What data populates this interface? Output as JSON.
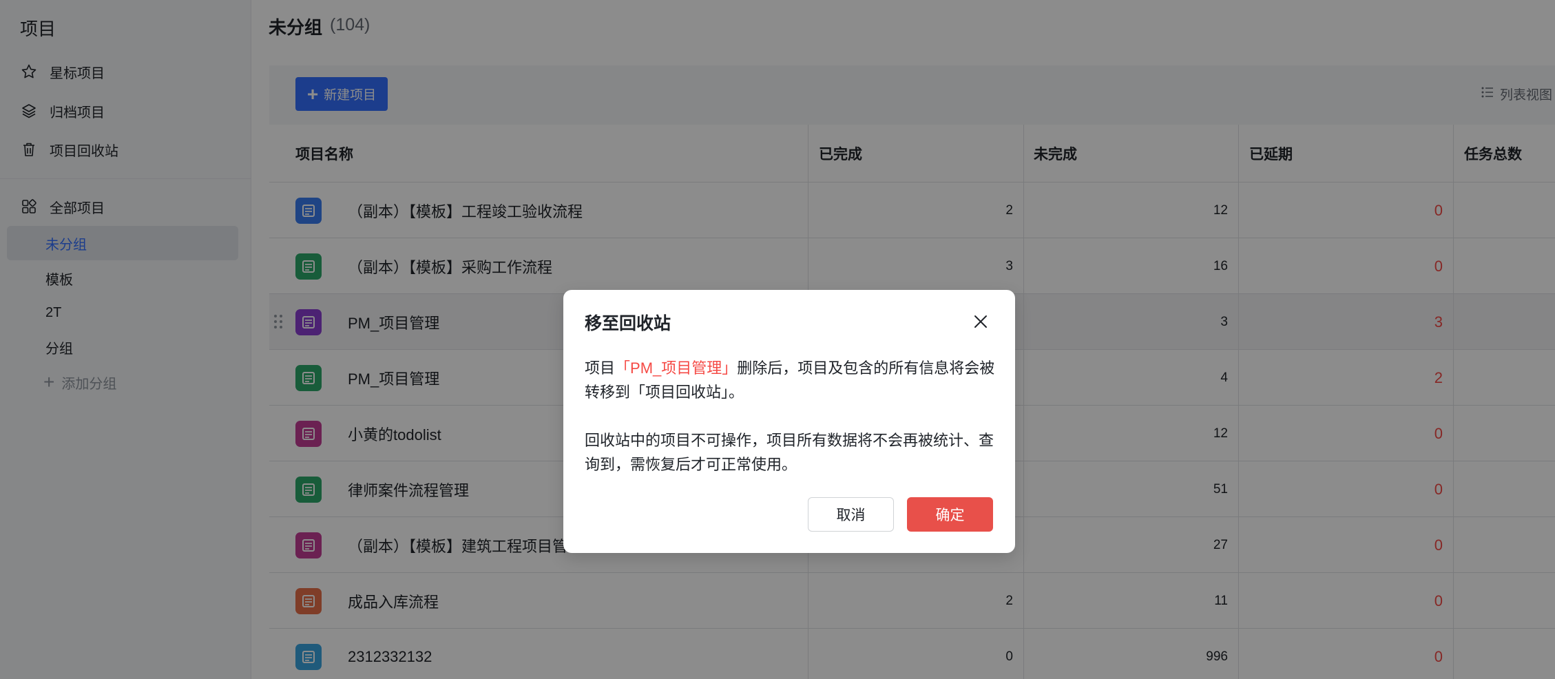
{
  "sidebar": {
    "title": "项目",
    "items": [
      {
        "label": "星标项目",
        "icon": "star-icon"
      },
      {
        "label": "归档项目",
        "icon": "layers-icon"
      },
      {
        "label": "项目回收站",
        "icon": "trash-icon"
      },
      {
        "label": "全部项目",
        "icon": "grid-icon"
      }
    ],
    "groups": [
      {
        "label": "未分组"
      },
      {
        "label": "模板"
      },
      {
        "label": "2T"
      },
      {
        "label": "分组"
      }
    ],
    "add_group_label": "添加分组"
  },
  "main": {
    "title": "未分组",
    "count": "(104)",
    "new_button_label": "新建项目",
    "view_label": "列表视图",
    "columns": [
      "项目名称",
      "已完成",
      "未完成",
      "已延期",
      "任务总数"
    ],
    "rows": [
      {
        "name": "（副本）【模板】工程竣工验收流程",
        "done": "2",
        "undone": "12",
        "delayed": "0",
        "icon_color": "#3a7cf0"
      },
      {
        "name": "（副本）【模板】采购工作流程",
        "done": "3",
        "undone": "16",
        "delayed": "0",
        "icon_color": "#2ca86a"
      },
      {
        "name": "PM_项目管理",
        "done": "",
        "undone": "3",
        "delayed": "3",
        "icon_color": "#8a3fd1"
      },
      {
        "name": "PM_项目管理",
        "done": "",
        "undone": "4",
        "delayed": "2",
        "icon_color": "#2ca86a"
      },
      {
        "name": "小黄的todolist",
        "done": "",
        "undone": "12",
        "delayed": "0",
        "icon_color": "#c43d96"
      },
      {
        "name": "律师案件流程管理",
        "done": "",
        "undone": "51",
        "delayed": "0",
        "icon_color": "#2ca86a"
      },
      {
        "name": "（副本）【模板】建筑工程项目管理",
        "done": "",
        "undone": "27",
        "delayed": "0",
        "icon_color": "#c43d96"
      },
      {
        "name": "成品入库流程",
        "done": "2",
        "undone": "11",
        "delayed": "0",
        "icon_color": "#e8704a"
      },
      {
        "name": "2312332132",
        "done": "0",
        "undone": "996",
        "delayed": "0",
        "icon_color": "#3aa5e0"
      }
    ]
  },
  "dialog": {
    "title": "移至回收站",
    "body_prefix": "项目",
    "highlight": "「PM_项目管理」",
    "body_suffix": "删除后，项目及包含的所有信息将会被转移到「项目回收站」。",
    "body_p2": "回收站中的项目不可操作，项目所有数据将不会再被统计、查询到，需恢复后才可正常使用。",
    "cancel_label": "取消",
    "confirm_label": "确定"
  }
}
